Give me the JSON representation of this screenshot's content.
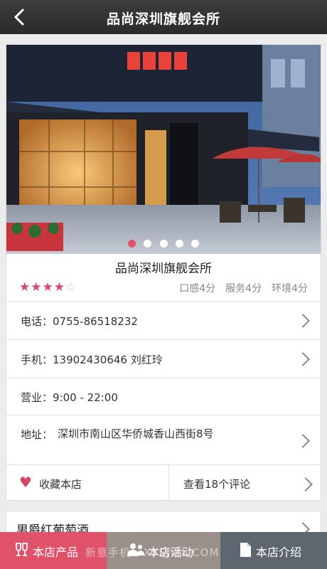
{
  "header": {
    "title": "品尚深圳旗舰会所"
  },
  "carousel": {
    "slides": 5,
    "active_index": 0
  },
  "shop": {
    "name": "品尚深圳旗舰会所",
    "stars": 4,
    "max_stars": 5,
    "ratings": [
      "口感4分",
      "服务4分",
      "环境4分"
    ]
  },
  "contact": {
    "phone": "电话：0755-86518232",
    "mobile": "手机：13902430646 刘红玲",
    "hours": "营业：9:00 - 22:00",
    "address_label": "地址：",
    "address_value": "深圳市南山区华侨城香山西街8号"
  },
  "actions": {
    "favorite_label": "收藏本店",
    "reviews_label": "查看18个评论"
  },
  "product_preview": {
    "label": "男爵红葡萄酒"
  },
  "tabbar": {
    "products": "本店产品",
    "activities": "本店活动",
    "intro": "本店介绍"
  },
  "watermark": "新意手机 - XYSJWL.COM",
  "colors": {
    "accent": "#d94566",
    "tab_products": "#e0526a",
    "tab_activities": "#9a8f8b",
    "tab_intro": "#5e6670"
  }
}
